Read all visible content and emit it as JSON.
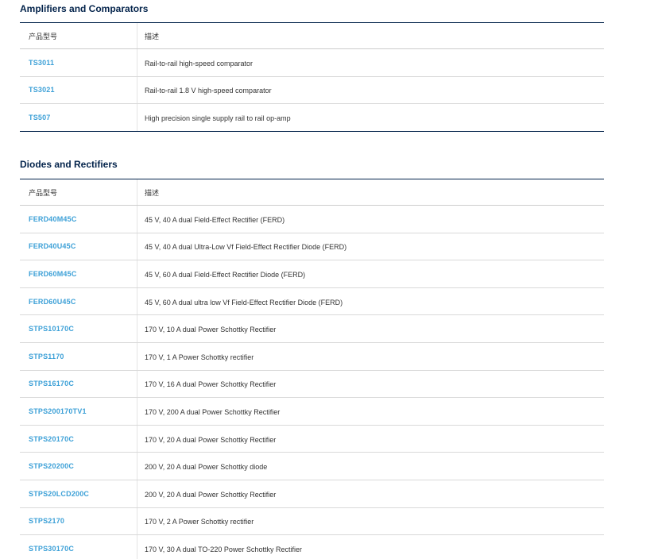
{
  "sections": [
    {
      "title": "Amplifiers and Comparators",
      "headers": {
        "part": "产品型号",
        "desc": "描述"
      },
      "rows": [
        {
          "part": "TS3011",
          "desc": "Rail-to-rail high-speed comparator"
        },
        {
          "part": "TS3021",
          "desc": "Rail-to-rail 1.8 V high-speed comparator"
        },
        {
          "part": "TS507",
          "desc": "High precision single supply rail to rail op-amp"
        }
      ]
    },
    {
      "title": "Diodes and Rectifiers",
      "headers": {
        "part": "产品型号",
        "desc": "描述"
      },
      "rows": [
        {
          "part": "FERD40M45C",
          "desc": "45 V, 40 A dual Field-Effect Rectifier (FERD)"
        },
        {
          "part": "FERD40U45C",
          "desc": "45 V, 40 A dual Ultra-Low Vf Field-Effect Rectifier Diode (FERD)"
        },
        {
          "part": "FERD60M45C",
          "desc": "45 V, 60 A dual Field-Effect Rectifier Diode (FERD)"
        },
        {
          "part": "FERD60U45C",
          "desc": "45 V, 60 A dual ultra low Vf Field-Effect Rectifier Diode (FERD)"
        },
        {
          "part": "STPS10170C",
          "desc": "170 V, 10 A dual Power Schottky Rectifier"
        },
        {
          "part": "STPS1170",
          "desc": "170 V, 1 A Power Schottky rectifier"
        },
        {
          "part": "STPS16170C",
          "desc": "170 V, 16 A dual Power Schottky Rectifier"
        },
        {
          "part": "STPS200170TV1",
          "desc": "170 V, 200 A dual Power Schottky Rectifier"
        },
        {
          "part": "STPS20170C",
          "desc": "170 V, 20 A dual Power Schottky Rectifier"
        },
        {
          "part": "STPS20200C",
          "desc": "200 V, 20 A dual Power Schottky diode"
        },
        {
          "part": "STPS20LCD200C",
          "desc": "200 V, 20 A dual Power Schottky Rectifier"
        },
        {
          "part": "STPS2170",
          "desc": "170 V, 2 A Power Schottky rectifier"
        },
        {
          "part": "STPS30170C",
          "desc": "170 V, 30 A dual TO-220 Power Schottky Rectifier"
        }
      ]
    }
  ]
}
